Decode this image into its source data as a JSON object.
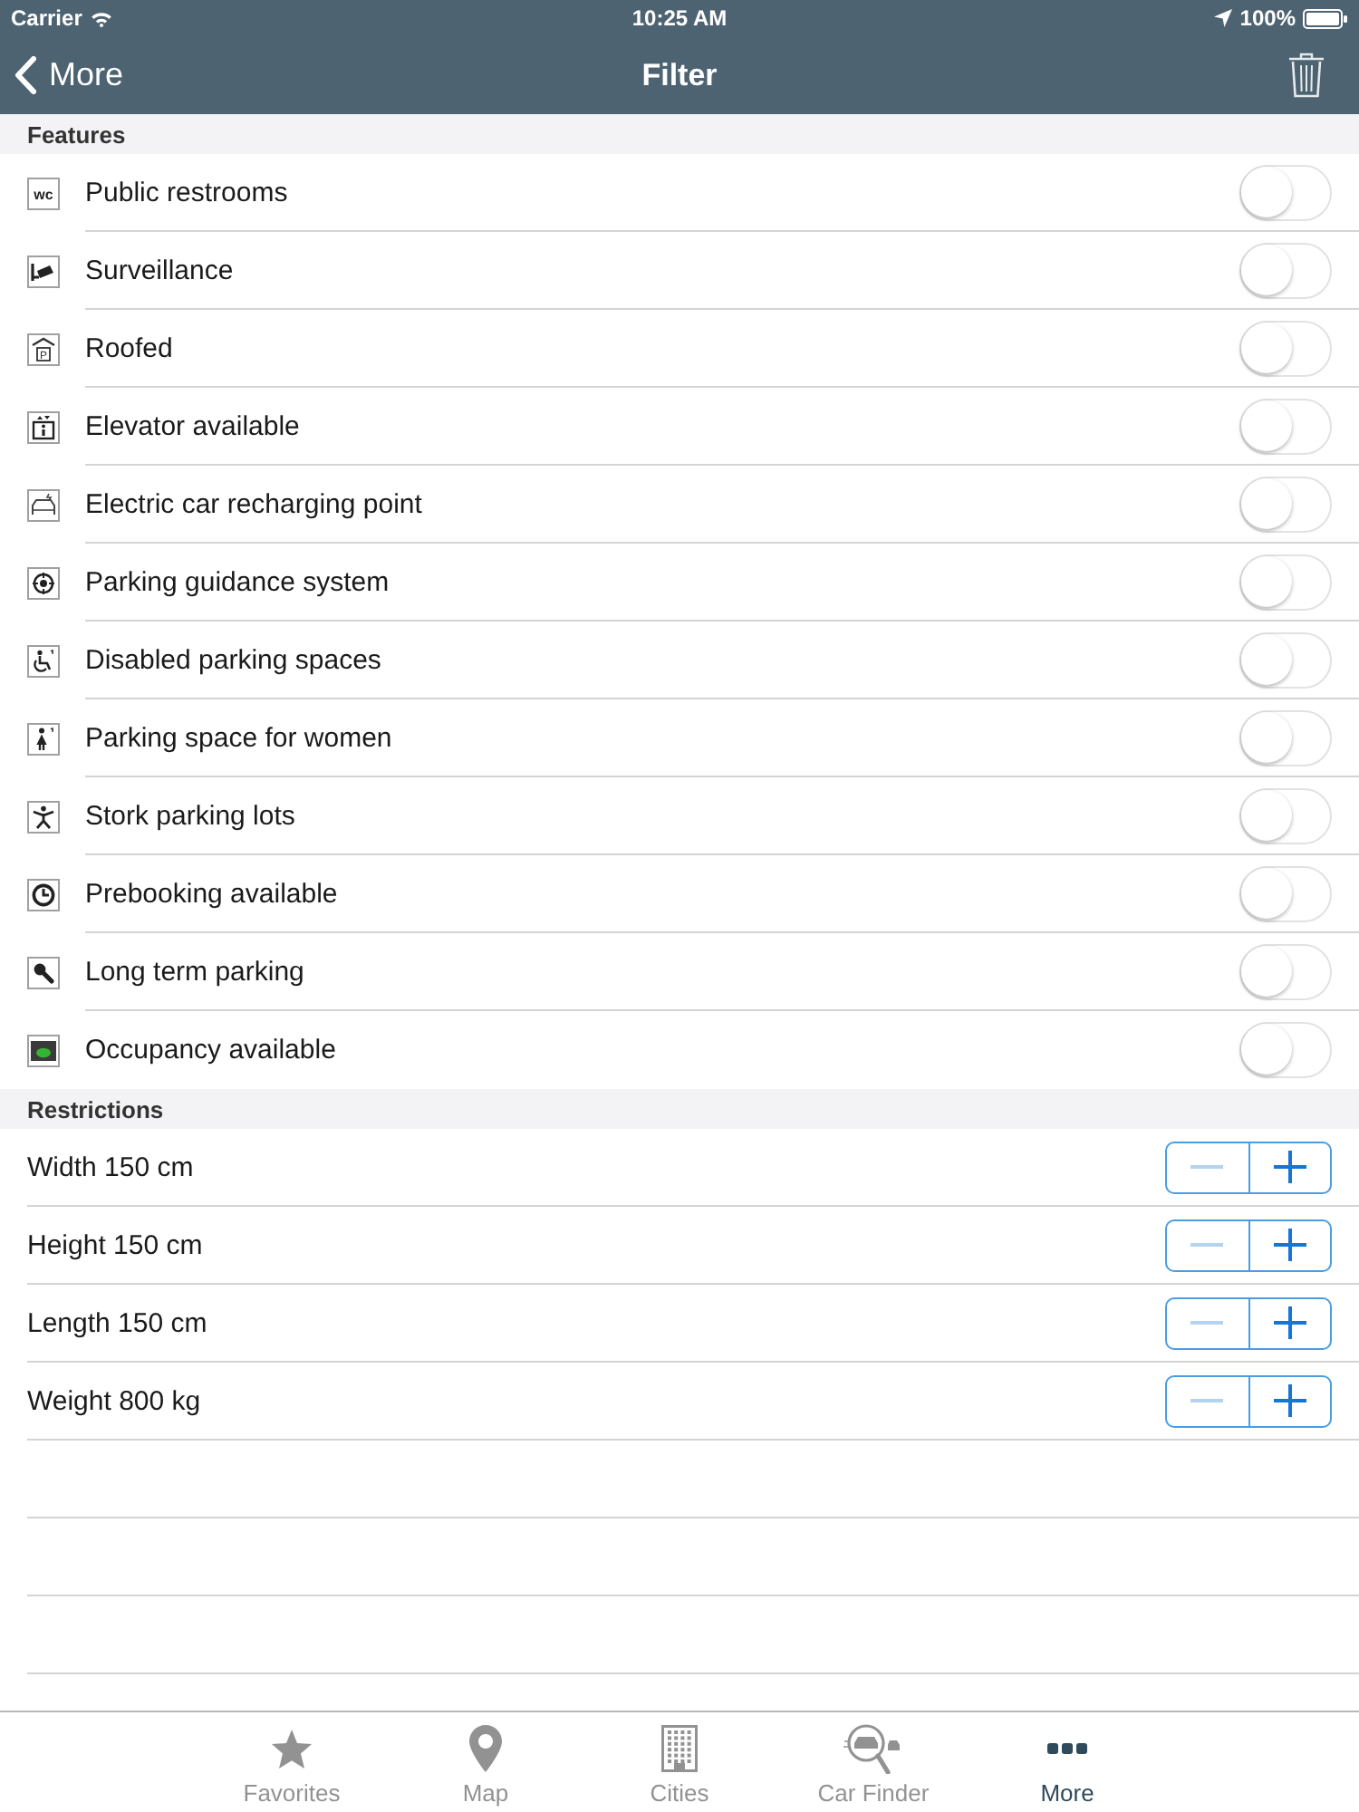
{
  "status_bar": {
    "carrier": "Carrier",
    "time": "10:25 AM",
    "battery": "100%"
  },
  "nav": {
    "back": "More",
    "title": "Filter"
  },
  "features": {
    "title": "Features",
    "items": [
      {
        "label": "Public restrooms",
        "icon_text": "wc",
        "on": false
      },
      {
        "label": "Surveillance",
        "on": false
      },
      {
        "label": "Roofed",
        "icon_text": "P",
        "on": false
      },
      {
        "label": "Elevator available",
        "on": false
      },
      {
        "label": "Electric car recharging point",
        "on": false
      },
      {
        "label": "Parking guidance system",
        "on": false
      },
      {
        "label": "Disabled parking spaces",
        "on": false
      },
      {
        "label": "Parking space for women",
        "on": false
      },
      {
        "label": "Stork parking lots",
        "on": false
      },
      {
        "label": "Prebooking available",
        "on": false
      },
      {
        "label": "Long term parking",
        "on": false
      },
      {
        "label": "Occupancy available",
        "on": false
      }
    ]
  },
  "restrictions": {
    "title": "Restrictions",
    "items": [
      {
        "label": "Width 150 cm",
        "decrease_disabled": true
      },
      {
        "label": "Height 150 cm",
        "decrease_disabled": true
      },
      {
        "label": "Length 150 cm",
        "decrease_disabled": true
      },
      {
        "label": "Weight 800 kg",
        "decrease_disabled": true
      }
    ]
  },
  "tabs": [
    {
      "label": "Favorites",
      "selected": false
    },
    {
      "label": "Map",
      "selected": false
    },
    {
      "label": "Cities",
      "selected": false
    },
    {
      "label": "Car Finder",
      "selected": false
    },
    {
      "label": "More",
      "selected": true
    }
  ]
}
